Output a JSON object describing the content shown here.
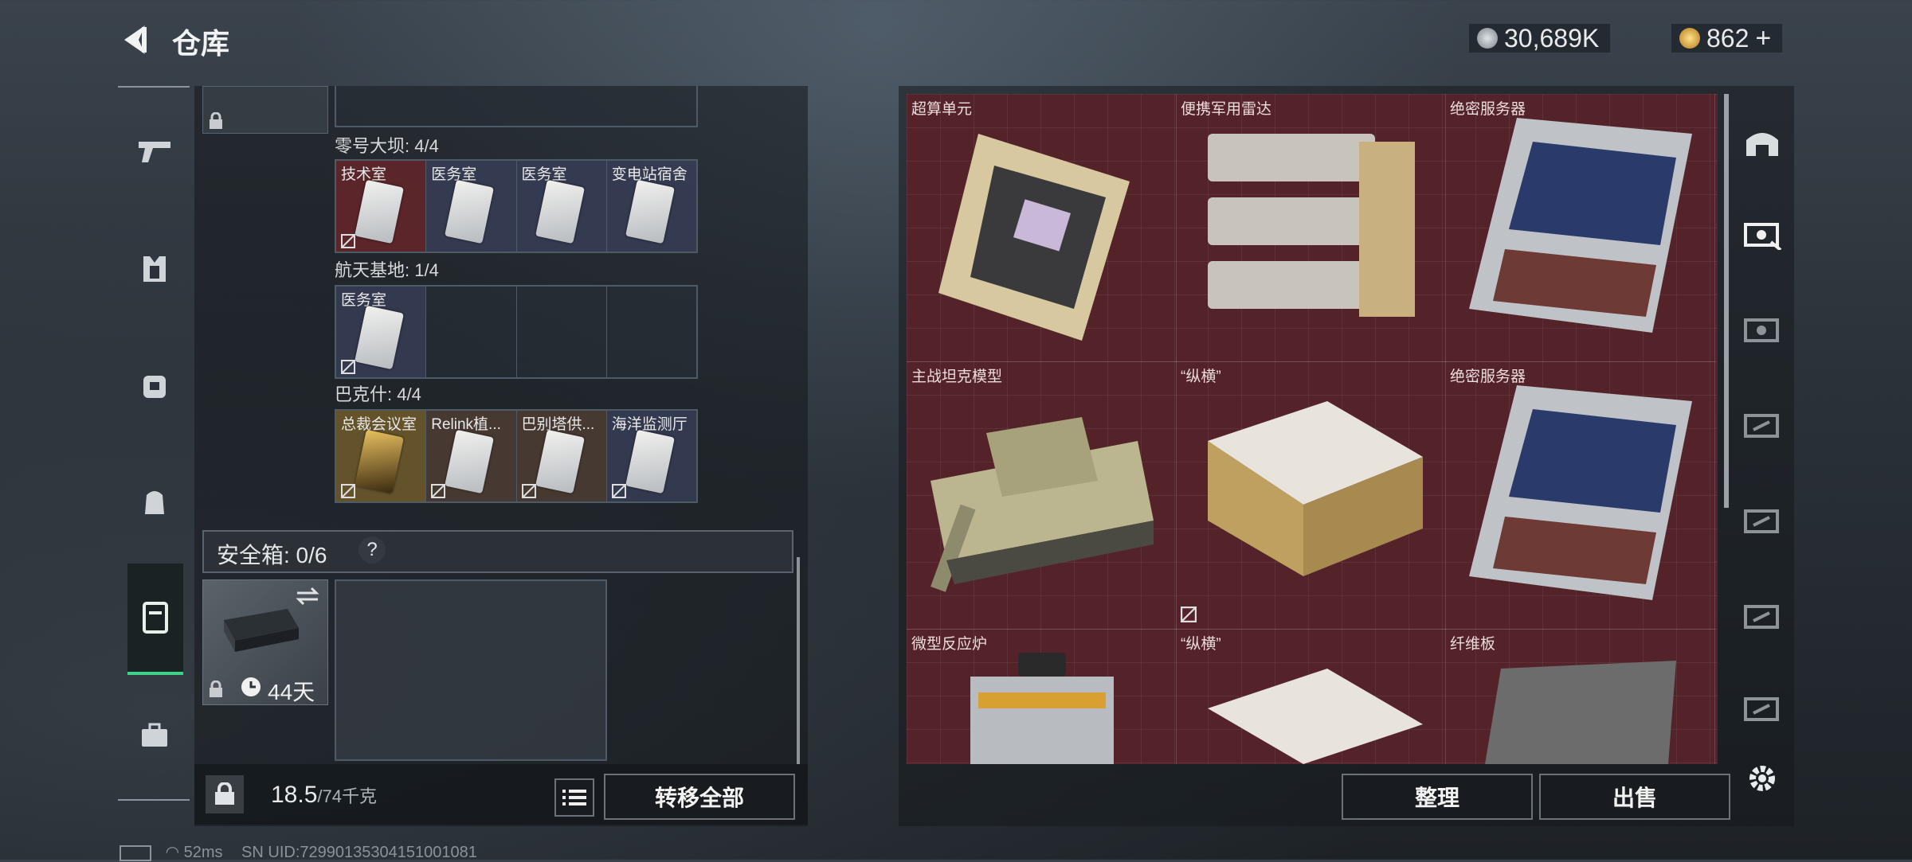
{
  "header": {
    "title": "仓库",
    "currency1": "30,689K",
    "currency2": "862"
  },
  "left": {
    "groups": [
      {
        "label": "零号大坝: 4/4",
        "cards": [
          "技术室",
          "医务室",
          "医务室",
          "变电站宿舍"
        ]
      },
      {
        "label": "航天基地: 1/4",
        "cards": [
          "医务室",
          "",
          "",
          ""
        ]
      },
      {
        "label": "巴克什: 4/4",
        "cards": [
          "总裁会议室",
          "Relink植...",
          "巴别塔供...",
          "海洋监测厅"
        ]
      }
    ],
    "safe_label": "安全箱: 0/6",
    "help": "?",
    "days": "44天",
    "weight": "18.5",
    "weight_max": "/74千克",
    "transfer_all": "转移全部"
  },
  "right": {
    "items": [
      "超算单元",
      "便携军用雷达",
      "绝密服务器",
      "主战坦克模型",
      "“纵横”",
      "绝密服务器",
      "微型反应炉",
      "“纵横”",
      "纤维板"
    ],
    "sort_label": "整理",
    "sell_label": "出售"
  },
  "status": {
    "ping": "52ms",
    "uid": "SN UID:72990135304151001081"
  },
  "colors": {
    "accent": "#3fd28a",
    "item_bg": "#54232a"
  }
}
